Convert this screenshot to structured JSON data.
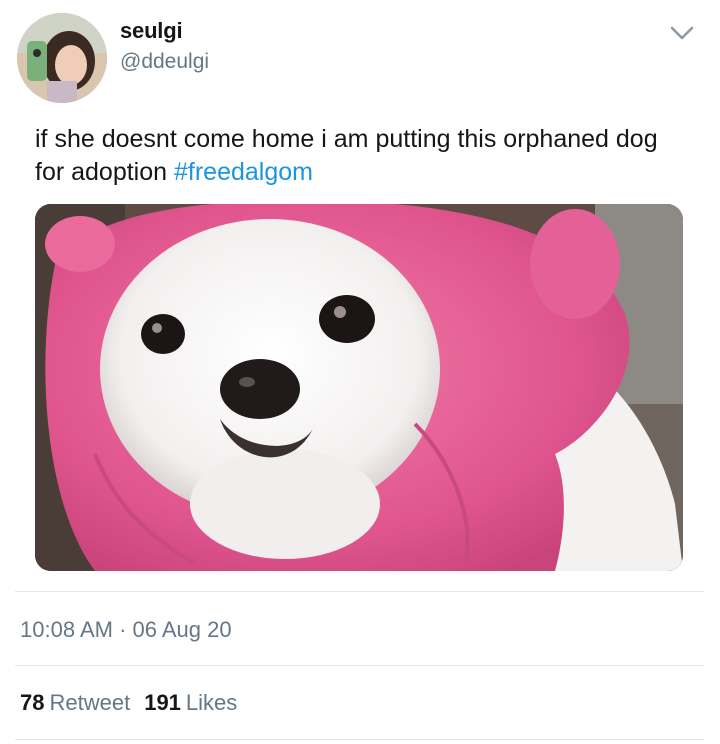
{
  "tweet": {
    "author": {
      "display_name": "seulgi",
      "handle": "@ddeulgi",
      "avatar_icon": "profile-photo"
    },
    "text": "if she doesnt come home i am putting this orphaned dog for adoption",
    "hashtag": "#freedalgom",
    "media": {
      "description_icon": "dog-in-pink-hoodie-photo"
    },
    "timestamp": "10:08 AM · 06 Aug 20",
    "retweets": {
      "count": "78",
      "label": "Retweet"
    },
    "likes": {
      "count": "191",
      "label": "Likes"
    }
  },
  "colors": {
    "text": "#14171a",
    "secondary": "#657786",
    "link": "#1b95e0",
    "divider": "#e1e8ed"
  }
}
